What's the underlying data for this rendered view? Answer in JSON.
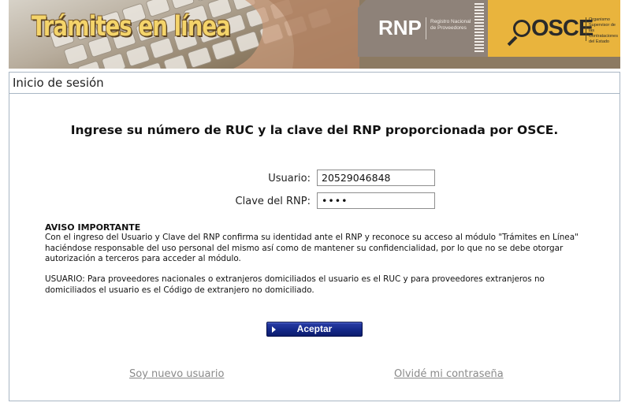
{
  "banner": {
    "title": "Trámites en línea",
    "rnp_logo": "RNP",
    "rnp_desc": "Registro Nacional de Proveedores",
    "osce_logo": "OSCE",
    "osce_desc": "Organismo Supervisor de las Contrataciones del Estado",
    "colors": {
      "rnp": "#8e8279",
      "osce": "#e9b43d",
      "title": "#f4d46a"
    }
  },
  "panel": {
    "title": "Inicio de sesión"
  },
  "login": {
    "headline": "Ingrese su número de RUC y la clave del RNP proporcionada por OSCE.",
    "user_label": "Usuario:",
    "user_value": "20529046848",
    "password_label": "Clave del RNP:",
    "password_value": "••••"
  },
  "notice": {
    "title": "AVISO IMPORTANTE",
    "body": "Con el ingreso del Usuario y Clave del RNP confirma su identidad ante el RNP y reconoce su acceso al módulo \"Trámites en Línea\" haciéndose responsable del uso personal del mismo así como de mantener su confidencialidad, por lo que no se debe otorgar autorización a terceros para acceder al módulo.",
    "user_info": "USUARIO: Para proveedores nacionales o extranjeros domiciliados el usuario es el RUC y para proveedores extranjeros no domiciliados el usuario es el Código de extranjero no domiciliado."
  },
  "actions": {
    "accept_label": "Aceptar",
    "new_user_link": "Soy nuevo usuario",
    "forgot_password_link": "Olvidé mi contraseña"
  }
}
